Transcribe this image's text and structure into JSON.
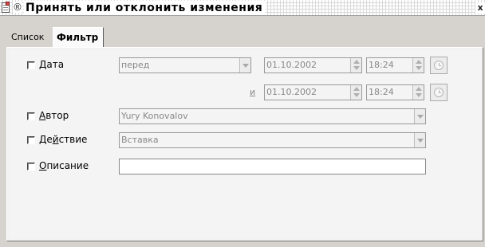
{
  "window": {
    "title": "Принять или отклонить изменения",
    "close_glyph": "x",
    "title_glyph": "®"
  },
  "tabs": [
    {
      "label": "Список",
      "active": false
    },
    {
      "label": "Фильтр",
      "active": true
    }
  ],
  "filter": {
    "date": {
      "label_first": "Д",
      "label_rest": "ата",
      "checked": false,
      "condition": "перед",
      "date1": "01.10.2002",
      "time1": "18:24",
      "and_label": "и",
      "date2": "01.10.2002",
      "time2": "18:24"
    },
    "author": {
      "label_first": "А",
      "label_rest": "втор",
      "checked": false,
      "value": "Yury Konovalov"
    },
    "action": {
      "label_pre": "Де",
      "label_ul": "й",
      "label_post": "ствие",
      "checked": false,
      "value": "Вставка"
    },
    "comment": {
      "label_first": "О",
      "label_rest": "писание",
      "checked": false,
      "value": ""
    }
  },
  "icons": {
    "window": "document-edit-icon",
    "clock": "clock-icon",
    "dropdown": "chevron-down-icon",
    "spin": "spin-arrows-icon"
  }
}
